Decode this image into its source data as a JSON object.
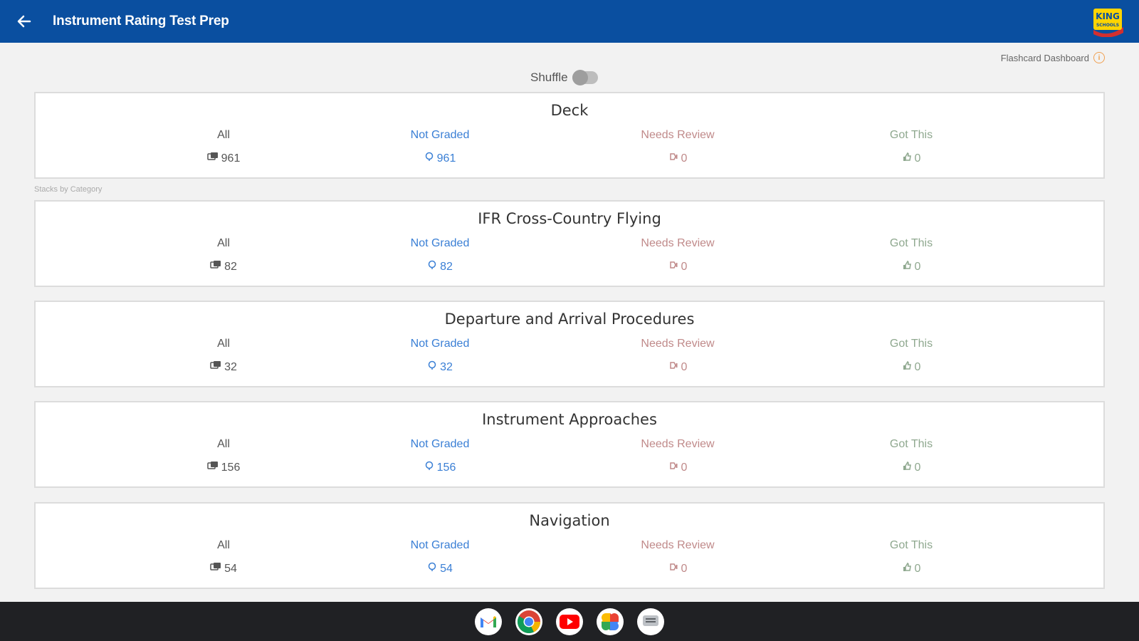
{
  "app": {
    "title": "Instrument Rating Test Prep",
    "brand_color": "#0a4fa0"
  },
  "header": {
    "dashboard_link": "Flashcard Dashboard",
    "shuffle_label": "Shuffle",
    "shuffle_on": false
  },
  "section_caption": "Stacks by Category",
  "colors": {
    "all": "#555555",
    "not_graded": "#3a7fd5",
    "needs_review": "#c08a8a",
    "got_this": "#8fa88f"
  },
  "labels": {
    "all": "All",
    "not_graded": "Not Graded",
    "needs_review": "Needs Review",
    "got_this": "Got This"
  },
  "cards": [
    {
      "title": "Deck",
      "all": "961",
      "not_graded": "961",
      "needs_review": "0",
      "got_this": "0"
    },
    {
      "title": "IFR Cross-Country Flying",
      "all": "82",
      "not_graded": "82",
      "needs_review": "0",
      "got_this": "0"
    },
    {
      "title": "Departure and Arrival Procedures",
      "all": "32",
      "not_graded": "32",
      "needs_review": "0",
      "got_this": "0"
    },
    {
      "title": "Instrument Approaches",
      "all": "156",
      "not_graded": "156",
      "needs_review": "0",
      "got_this": "0"
    },
    {
      "title": "Navigation",
      "all": "54",
      "not_graded": "54",
      "needs_review": "0",
      "got_this": "0"
    }
  ],
  "taskbar": {
    "apps": [
      "gmail-icon",
      "chrome-icon",
      "youtube-icon",
      "photos-icon",
      "messages-icon"
    ]
  }
}
